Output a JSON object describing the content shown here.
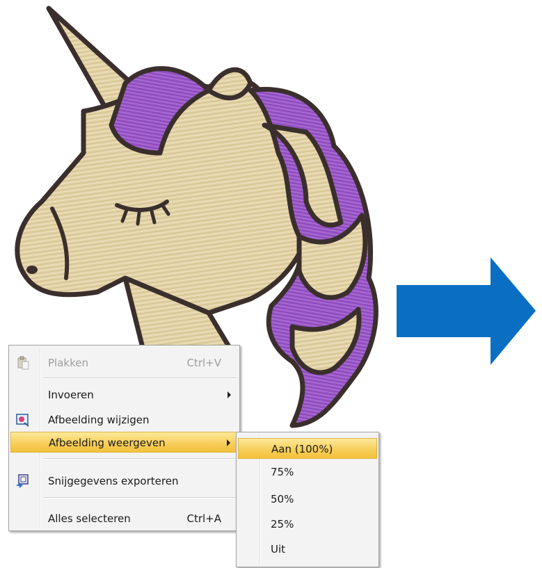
{
  "context_menu": {
    "items": [
      {
        "label": "Plakken",
        "shortcut": "Ctrl+V",
        "icon": "paste-icon"
      },
      {
        "label": "Invoeren",
        "submenu": true
      },
      {
        "label": "Afbeelding wijzigen",
        "icon": "image-edit-icon"
      },
      {
        "label": "Afbeelding weergeven",
        "submenu": true
      },
      {
        "label": "Snijgegevens exporteren",
        "icon": "export-cut-data-icon"
      },
      {
        "label": "Alles selecteren",
        "shortcut": "Ctrl+A"
      }
    ]
  },
  "submenu": {
    "items": [
      {
        "label": "Aan (100%)"
      },
      {
        "label": "75%"
      },
      {
        "label": "50%"
      },
      {
        "label": "25%"
      },
      {
        "label": "Uit"
      }
    ]
  },
  "colors": {
    "highlight": "#f7cd58",
    "arrow": "#0a6fc2",
    "embroidery_tan": "#e2d2a6",
    "embroidery_purple": "#9a58c8",
    "outline": "#3a2f2c"
  }
}
